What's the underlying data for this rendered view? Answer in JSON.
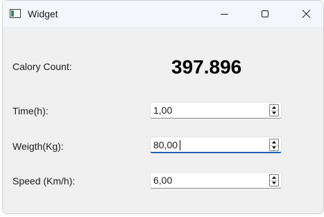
{
  "window": {
    "title": "Widget",
    "icon": "app-window-icon",
    "controls": {
      "minimize": "minimize-icon",
      "maximize": "maximize-icon",
      "close": "close-icon"
    }
  },
  "calory": {
    "label": "Calory Count:",
    "value": "397.896"
  },
  "fields": {
    "time": {
      "label": "Time(h):",
      "value": "1,00"
    },
    "weight": {
      "label": "Weigth(Kg):",
      "value": "80,00"
    },
    "speed": {
      "label": "Speed (Km/h):",
      "value": "6,00"
    }
  },
  "colors": {
    "accent": "#1f5fb5",
    "titlebar": "#f3f6fb",
    "window_bg": "#f0f0f0"
  }
}
